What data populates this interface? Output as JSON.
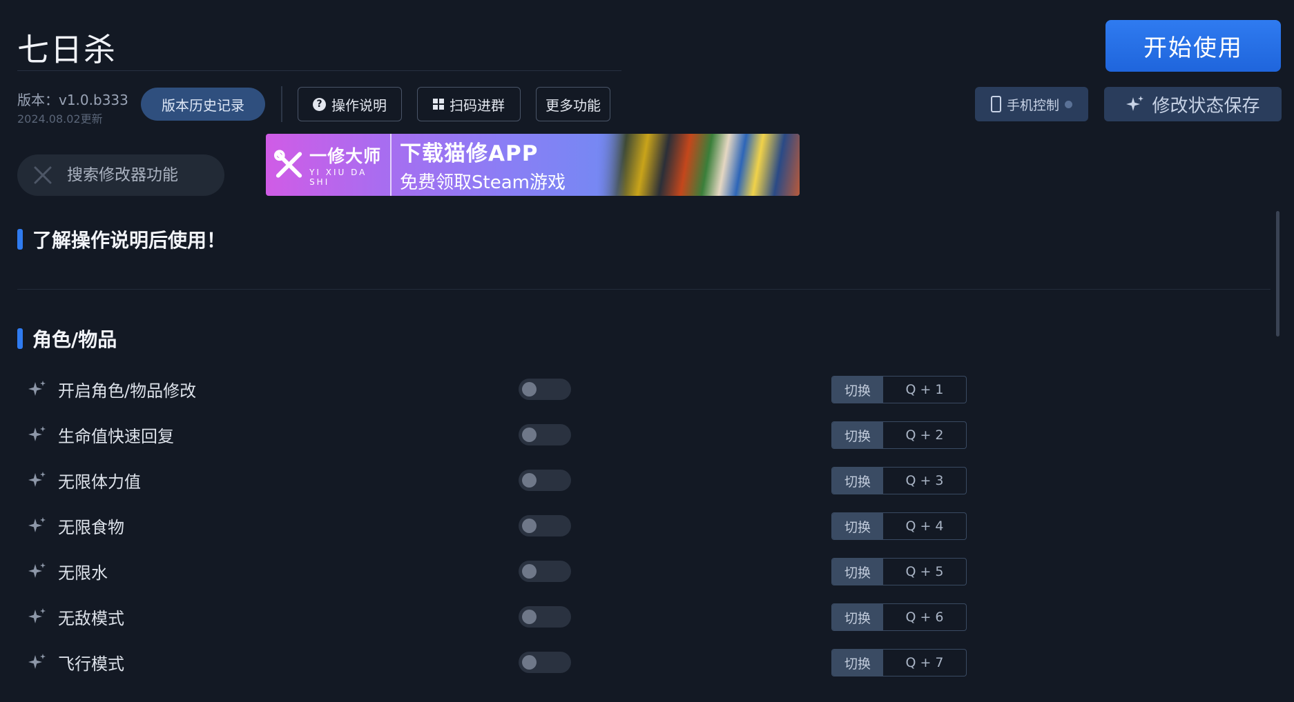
{
  "app": {
    "title": "七日杀",
    "start_label": "开始使用"
  },
  "version": {
    "label": "版本：v1.0.b333",
    "date": "2024.08.02更新",
    "history_label": "版本历史记录"
  },
  "toolbar": {
    "help_label": "操作说明",
    "scan_label": "扫码进群",
    "more_label": "更多功能"
  },
  "right": {
    "phone_label": "手机控制",
    "save_label": "修改状态保存"
  },
  "search": {
    "placeholder": "搜索修改器功能"
  },
  "banner": {
    "brand": "一修大师",
    "brand_pinyin": "YI XIU DA SHI",
    "title": "下载猫修APP",
    "subtitle": "免费领取Steam游戏"
  },
  "sections": {
    "intro": "了解操作说明后使用！",
    "category": "角色/物品"
  },
  "features": [
    {
      "name": "开启角色/物品修改",
      "enabled": false,
      "switch_label": "切换",
      "hotkey": "Q + 1"
    },
    {
      "name": "生命值快速回复",
      "enabled": false,
      "switch_label": "切换",
      "hotkey": "Q + 2"
    },
    {
      "name": "无限体力值",
      "enabled": false,
      "switch_label": "切换",
      "hotkey": "Q + 3"
    },
    {
      "name": "无限食物",
      "enabled": false,
      "switch_label": "切换",
      "hotkey": "Q + 4"
    },
    {
      "name": "无限水",
      "enabled": false,
      "switch_label": "切换",
      "hotkey": "Q + 5"
    },
    {
      "name": "无敌模式",
      "enabled": false,
      "switch_label": "切换",
      "hotkey": "Q + 6"
    },
    {
      "name": "飞行模式",
      "enabled": false,
      "switch_label": "切换",
      "hotkey": "Q + 7"
    }
  ],
  "colors": {
    "accent": "#2f7bf0",
    "background": "#131924",
    "button_dark": "#2a3d5c"
  }
}
